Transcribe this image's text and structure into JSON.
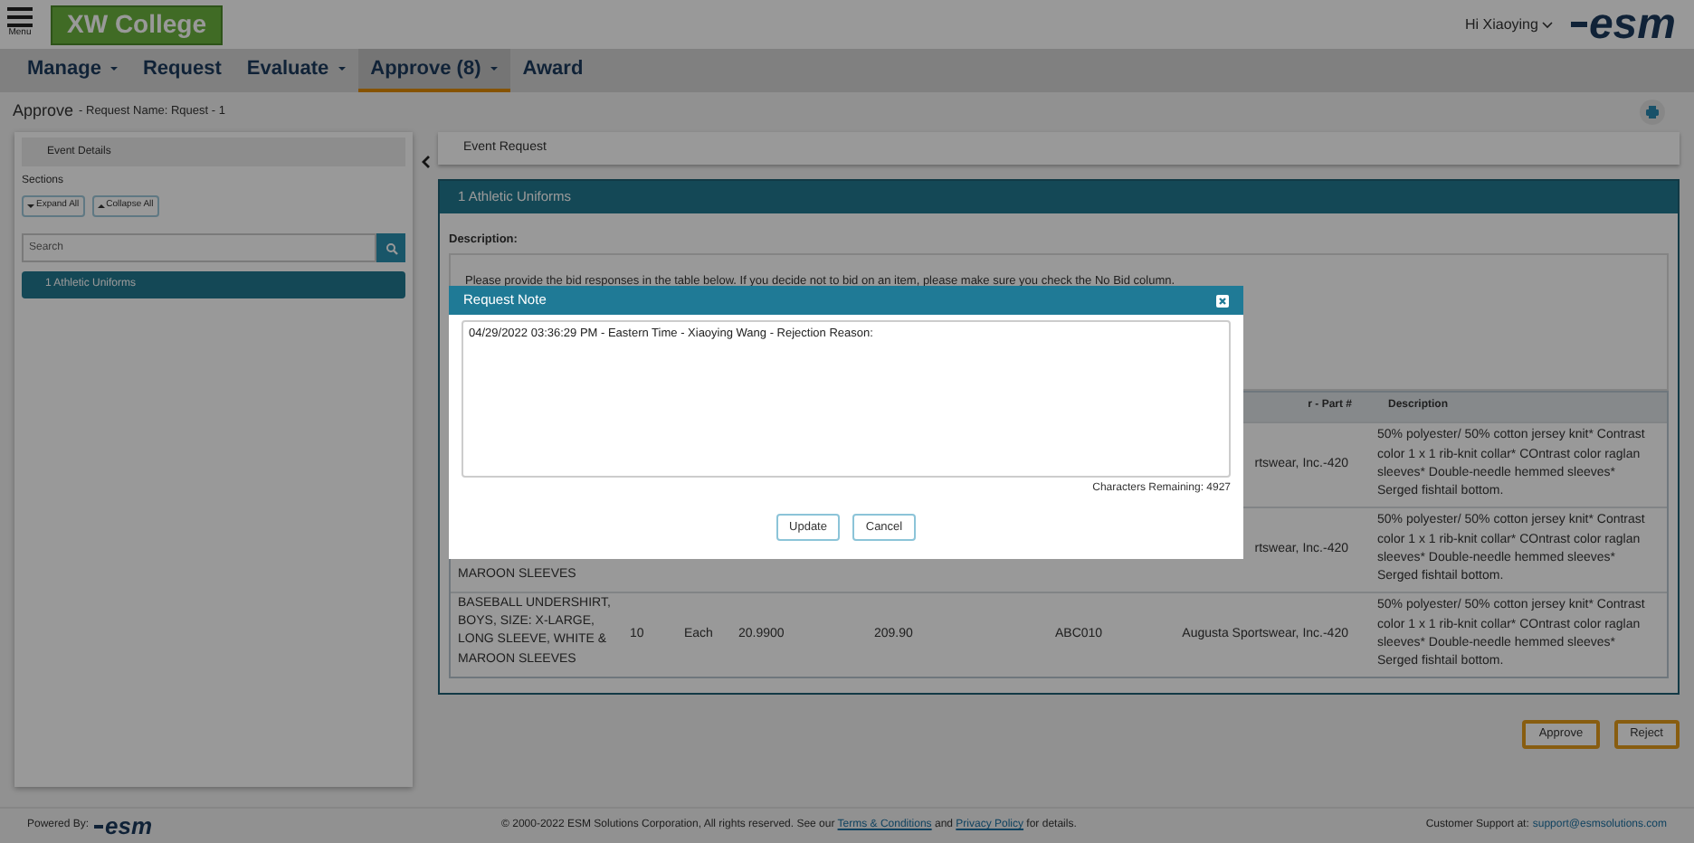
{
  "header": {
    "menu_label": "Menu",
    "logo_text": "XW College",
    "user_greeting": "Hi Xiaoying",
    "brand": "esm"
  },
  "nav": [
    {
      "label": "Manage",
      "dropdown": true,
      "selected": false
    },
    {
      "label": "Request",
      "dropdown": false,
      "selected": false
    },
    {
      "label": "Evaluate",
      "dropdown": true,
      "selected": false
    },
    {
      "label": "Approve (8)",
      "dropdown": true,
      "selected": true
    },
    {
      "label": "Award",
      "dropdown": false,
      "selected": false
    }
  ],
  "breadcrumb": {
    "title": "Approve",
    "detail": "- Request Name: Rquest - 1"
  },
  "sidebar": {
    "event_details": "Event Details",
    "sections_label": "Sections",
    "expand_all": "Expand All",
    "collapse_all": "Collapse All",
    "search_placeholder": "Search",
    "items": [
      {
        "label": "1 Athletic Uniforms",
        "selected": true
      }
    ]
  },
  "main": {
    "panel_title": "Event Request",
    "section_title": "1 Athletic Uniforms",
    "description_label": "Description:",
    "description_text": "Please provide the bid responses in the table below. If you decide not to bid on an item, please make sure you check the No Bid column.",
    "table": {
      "vendor_heading": "r - Part #",
      "description_heading": "Description",
      "rows": [
        {
          "vendor": "rtswear, Inc.-420",
          "description": "50% polyester/ 50% cotton jersey knit* Contrast color 1 x 1 rib-knit collar* COntrast color raglan sleeves* Double-needle hemmed sleeves* Serged fishtail bottom."
        },
        {
          "item": "MAROON SLEEVES",
          "vendor": "rtswear, Inc.-420",
          "description": "50% polyester/ 50% cotton jersey knit* Contrast color 1 x 1 rib-knit collar* COntrast color raglan sleeves* Double-needle hemmed sleeves* Serged fishtail bottom."
        },
        {
          "item": "BASEBALL UNDERSHIRT, BOYS, SIZE: X-LARGE, LONG SLEEVE, WHITE & MAROON SLEEVES",
          "qty": "10",
          "unit": "Each",
          "price": "20.9900",
          "extended": "209.90",
          "part": "ABC010",
          "vendor": "Augusta Sportswear, Inc.-420",
          "description": "50% polyester/ 50% cotton jersey knit* Contrast color 1 x 1 rib-knit collar* COntrast color raglan sleeves* Double-needle hemmed sleeves* Serged fishtail bottom."
        }
      ]
    },
    "actions": [
      "Approve",
      "Reject"
    ]
  },
  "modal": {
    "title": "Request Note",
    "note": "04/29/2022 03:36:29 PM - Eastern Time - Xiaoying Wang - Rejection Reason:",
    "remaining": "Characters Remaining: 4927",
    "buttons": [
      "Update",
      "Cancel"
    ]
  },
  "footer": {
    "powered_by": "Powered By:",
    "brand": "esm",
    "copyright_before": "© 2000-2022 ESM Solutions Corporation, All rights reserved. See our ",
    "terms_link": "Terms & Conditions",
    "between": " and ",
    "privacy_link": "Privacy Policy",
    "copyright_after": " for details.",
    "support_label": "Customer Support at: ",
    "support_link": "support@esmsolutions.com"
  }
}
